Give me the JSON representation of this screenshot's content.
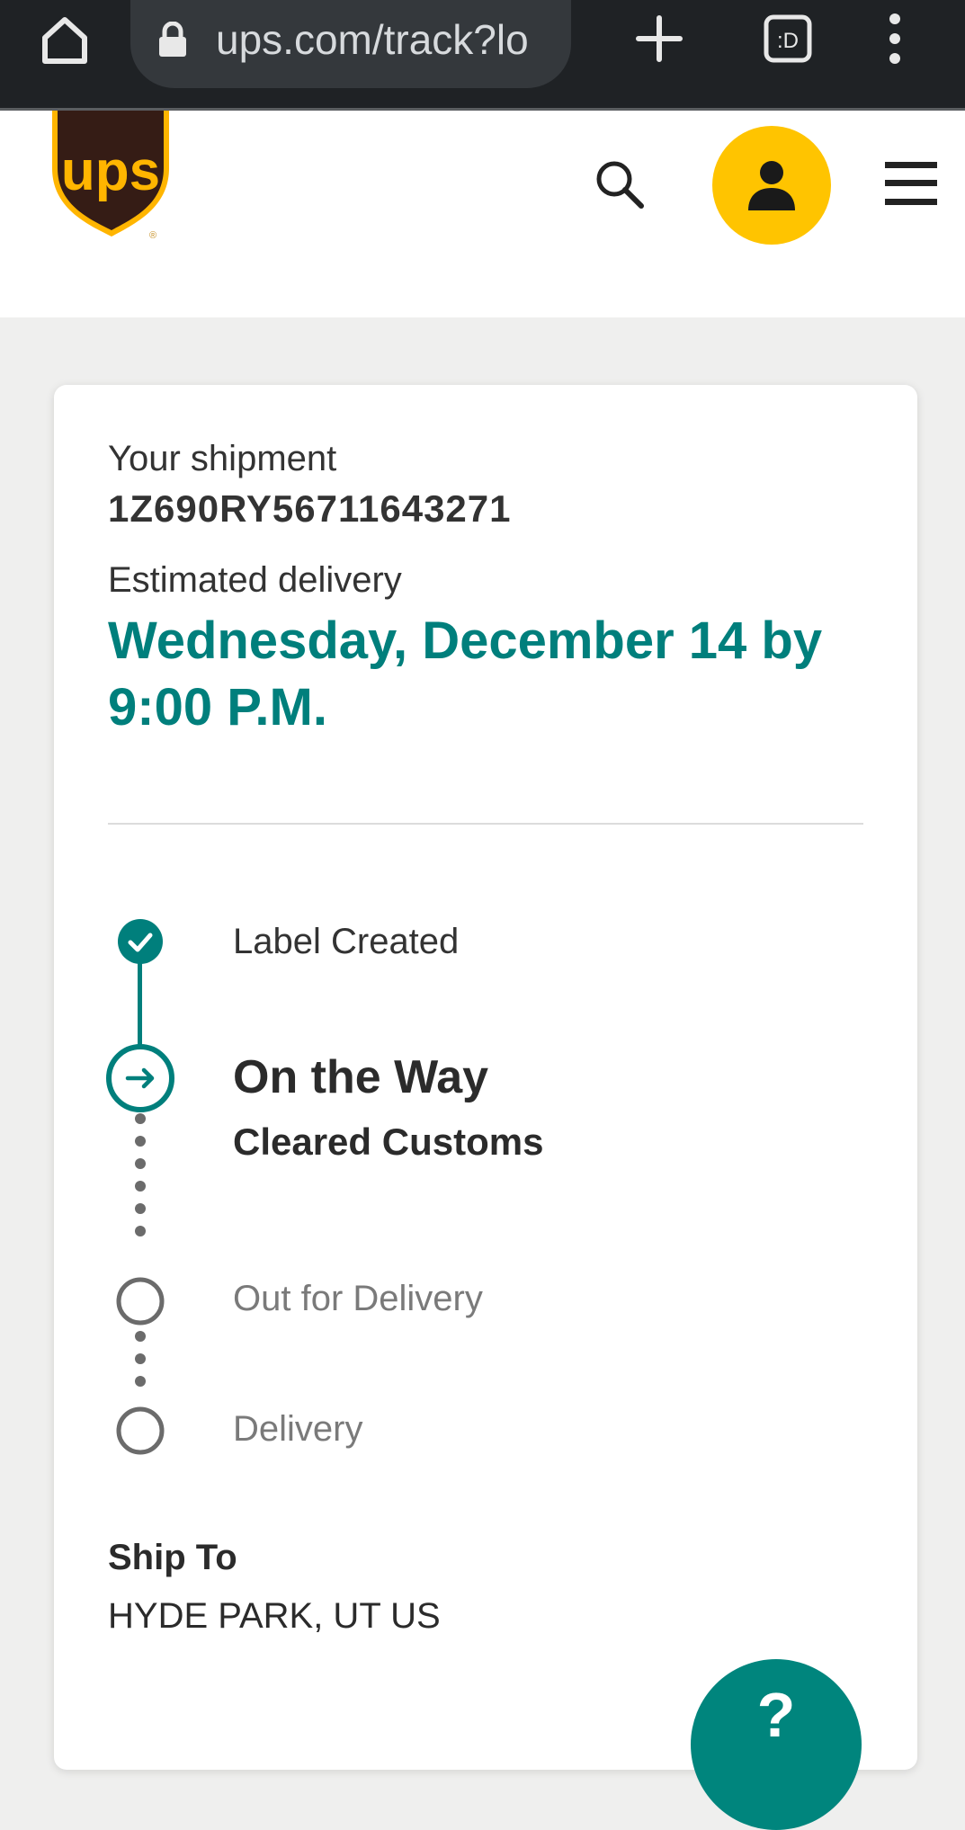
{
  "browser": {
    "url": "ups.com/track?lo"
  },
  "shipment": {
    "label": "Your shipment",
    "tracking_number": "1Z690RY56711643271",
    "estimated_label": "Estimated delivery",
    "estimated_date": "Wednesday, December 14 by 9:00 P.M."
  },
  "progress": {
    "steps": [
      {
        "label": "Label Created",
        "state": "complete"
      },
      {
        "label": "On the Way",
        "state": "current",
        "detail": "Cleared Customs"
      },
      {
        "label": "Out for Delivery",
        "state": "pending"
      },
      {
        "label": "Delivery",
        "state": "pending"
      }
    ]
  },
  "ship_to": {
    "label": "Ship To",
    "value": "HYDE PARK, UT US"
  },
  "help": {
    "glyph": "?"
  },
  "colors": {
    "brand_brown": "#351c15",
    "brand_gold": "#ffb500",
    "accent_teal": "#007f7c",
    "account_yellow": "#ffc400"
  }
}
